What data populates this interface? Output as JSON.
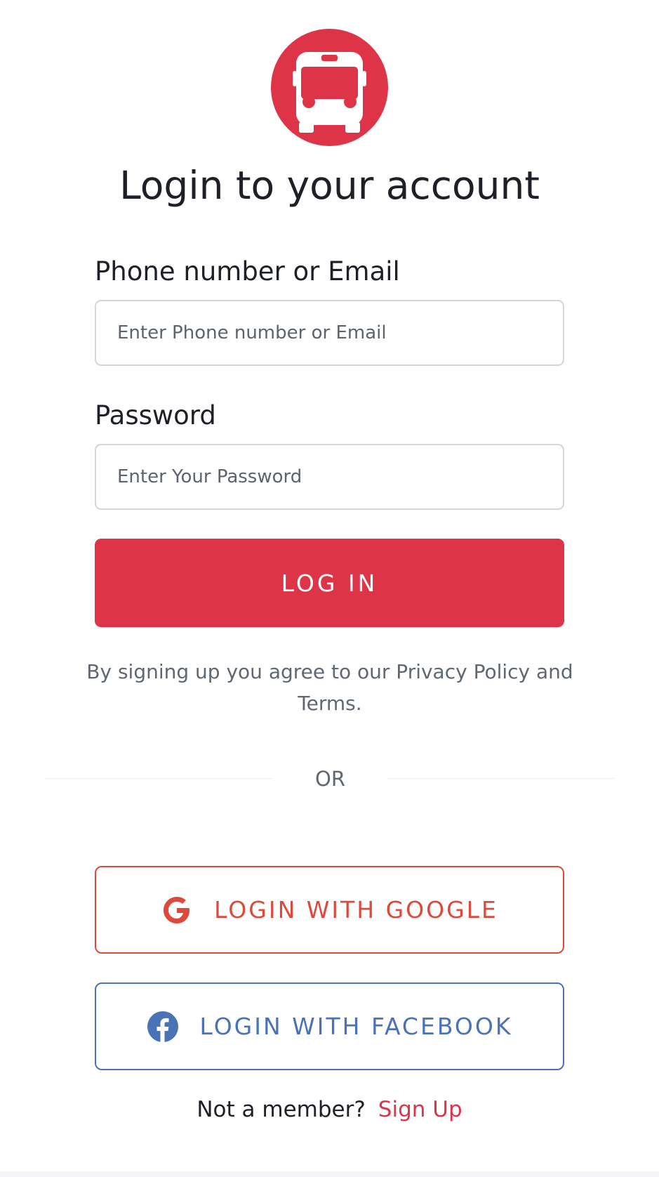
{
  "brand": {
    "logo_icon": "bus-icon",
    "accent_color": "#dd3447"
  },
  "page": {
    "title": "Login to your account"
  },
  "form": {
    "phone_label": "Phone number or Email",
    "phone_placeholder": "Enter Phone number or Email",
    "phone_value": "",
    "password_label": "Password",
    "password_placeholder": "Enter Your Password",
    "password_value": "",
    "submit_label": "LOG IN"
  },
  "terms": {
    "text": "By signing up you agree to our Privacy Policy and Terms."
  },
  "divider": {
    "label": "OR"
  },
  "social": {
    "google": {
      "label": "LOGIN WITH GOOGLE",
      "icon": "google-icon",
      "color": "#dd4a3c"
    },
    "facebook": {
      "label": "LOGIN WITH FACEBOOK",
      "icon": "facebook-icon",
      "color": "#4a73b5"
    }
  },
  "footer": {
    "question": "Not a member?",
    "signup_label": "Sign Up"
  }
}
